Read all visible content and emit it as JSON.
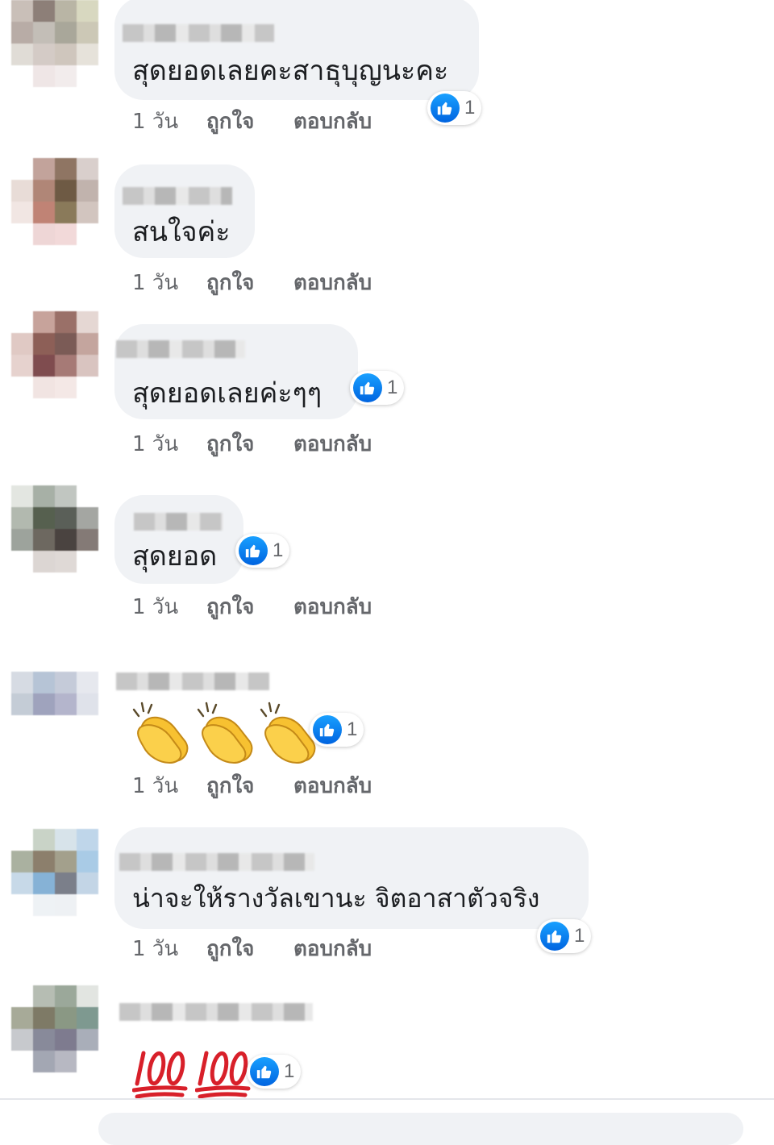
{
  "meta_labels": {
    "time": "1 วัน",
    "like": "ถูกใจ",
    "reply": "ตอบกลับ"
  },
  "colors": {
    "bubble": "#f0f2f5",
    "like_blue": "#1877f2",
    "meta_gray": "#65676b",
    "text": "#1c1e21"
  },
  "comments": [
    {
      "text": "สุดยอดเลยคะสาธุบุญนะคะ",
      "reactions": "1"
    },
    {
      "text": "สนใจค่ะ"
    },
    {
      "text": "สุดยอดเลยค่ะๆๆ",
      "reactions": "1"
    },
    {
      "text": "สุดยอด",
      "reactions": "1"
    },
    {
      "emoji": "clapping-hands x3",
      "reactions": "1"
    },
    {
      "text": "น่าจะให้รางวัลเขานะ จิตอาสาตัวจริง",
      "reactions": "1"
    },
    {
      "emoji": "hundred-points x2",
      "reactions": "1"
    }
  ]
}
